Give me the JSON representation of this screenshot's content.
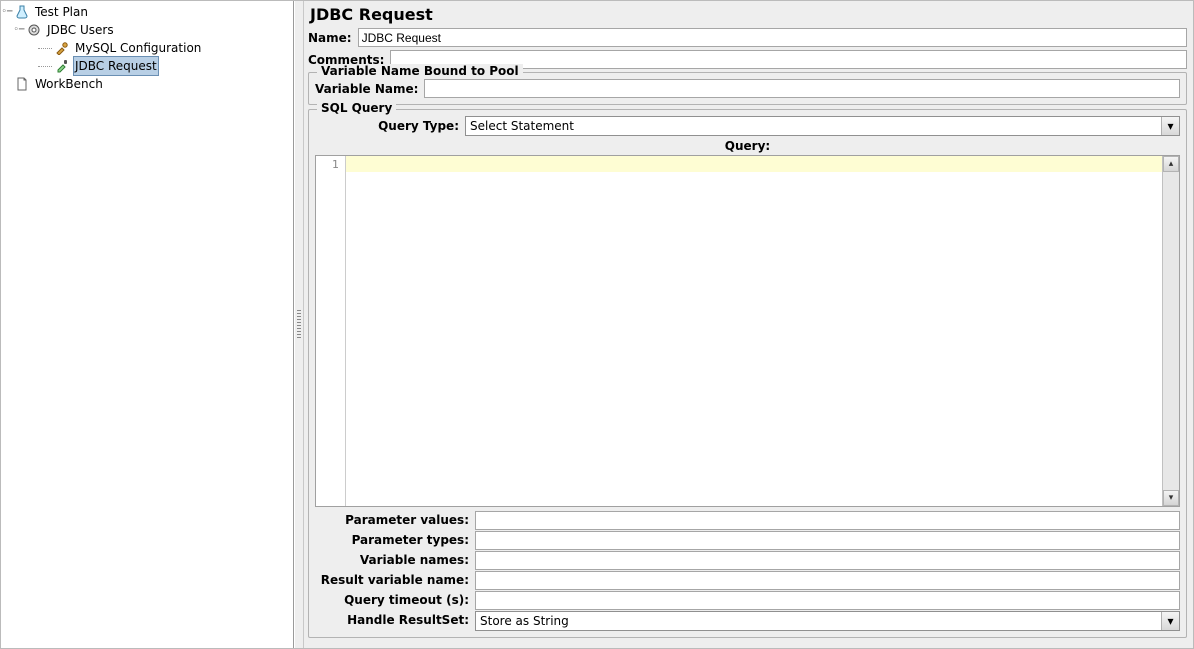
{
  "tree": {
    "root": "Test Plan",
    "users": "JDBC Users",
    "mysql": "MySQL Configuration",
    "jdbc": "JDBC Request",
    "workbench": "WorkBench"
  },
  "panel": {
    "title": "JDBC Request",
    "name_label": "Name:",
    "name_value": "JDBC Request",
    "comments_label": "Comments:",
    "comments_value": ""
  },
  "pool": {
    "legend": "Variable Name Bound to Pool",
    "label": "Variable Name:",
    "value": ""
  },
  "sql": {
    "legend": "SQL Query",
    "query_type_label": "Query Type:",
    "query_type_value": "Select Statement",
    "query_label": "Query:",
    "line_number": "1"
  },
  "params": {
    "parameter_values_label": "Parameter values:",
    "parameter_values_value": "",
    "parameter_types_label": "Parameter types:",
    "parameter_types_value": "",
    "variable_names_label": "Variable names:",
    "variable_names_value": "",
    "result_variable_name_label": "Result variable name:",
    "result_variable_name_value": "",
    "query_timeout_label": "Query timeout (s):",
    "query_timeout_value": "",
    "handle_resultset_label": "Handle ResultSet:",
    "handle_resultset_value": "Store as String"
  }
}
